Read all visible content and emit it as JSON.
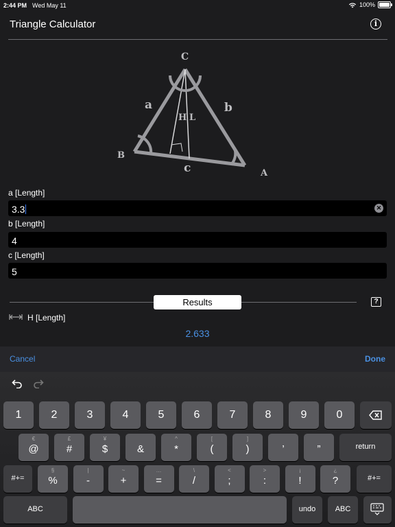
{
  "status": {
    "time": "2:44 PM",
    "date": "Wed May 11",
    "battery": "100%"
  },
  "header": {
    "title": "Triangle Calculator",
    "info_icon": "info-circle-icon"
  },
  "diagram": {
    "vertex_a": "A",
    "vertex_b": "B",
    "vertex_c": "C",
    "side_a": "a",
    "side_b": "b",
    "side_c": "c",
    "height": "H",
    "length": "L"
  },
  "fields": [
    {
      "label": "a [Length]",
      "value": "3.3"
    },
    {
      "label": "b [Length]",
      "value": "4"
    },
    {
      "label": "c [Length]",
      "value": "5"
    }
  ],
  "results": {
    "label": "Results",
    "help": "?",
    "h_label": "H [Length]",
    "h_value": "2.633"
  },
  "toolbar": {
    "cancel": "Cancel",
    "done": "Done"
  },
  "keyboard": {
    "num_row": [
      "1",
      "2",
      "3",
      "4",
      "5",
      "6",
      "7",
      "8",
      "9",
      "0"
    ],
    "row2": [
      {
        "alt": "€",
        "main": "@"
      },
      {
        "alt": "£",
        "main": "#"
      },
      {
        "alt": "¥",
        "main": "$"
      },
      {
        "alt": "",
        "main": "&"
      },
      {
        "alt": "^",
        "main": "*"
      },
      {
        "alt": "[",
        "main": "("
      },
      {
        "alt": "]",
        "main": ")"
      },
      {
        "alt": "",
        "main": "’"
      },
      {
        "alt": "",
        "main": "”"
      }
    ],
    "row3": [
      {
        "alt": "§",
        "main": "%"
      },
      {
        "alt": "|",
        "main": "-"
      },
      {
        "alt": "~",
        "main": "+"
      },
      {
        "alt": "…",
        "main": "="
      },
      {
        "alt": "\\",
        "main": "/"
      },
      {
        "alt": "<",
        "main": ";"
      },
      {
        "alt": ">",
        "main": ":"
      },
      {
        "alt": "¡",
        "main": "!"
      },
      {
        "alt": "¿",
        "main": "?"
      }
    ],
    "return": "return",
    "shift_left": "#+=",
    "shift_right": "#+=",
    "abc_left": "ABC",
    "undo": "undo",
    "abc_right": "ABC"
  }
}
